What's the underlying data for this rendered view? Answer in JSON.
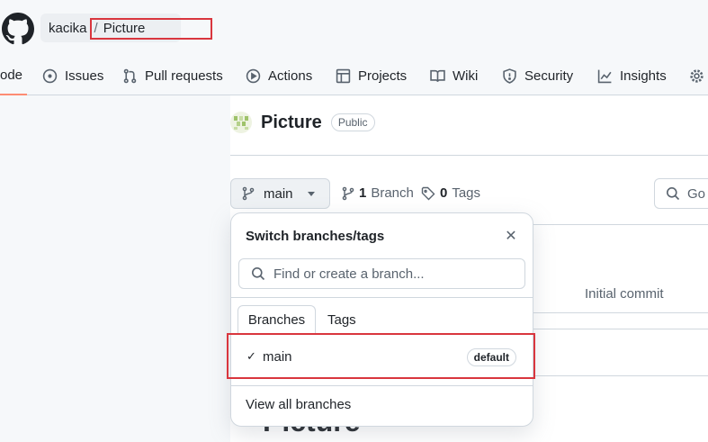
{
  "header": {
    "owner": "kacika",
    "separator": "/",
    "repo": "Picture"
  },
  "tabs": [
    {
      "label": "ode",
      "icon": "code-icon"
    },
    {
      "label": "Issues",
      "icon": "issue-icon"
    },
    {
      "label": "Pull requests",
      "icon": "pull-request-icon"
    },
    {
      "label": "Actions",
      "icon": "play-icon"
    },
    {
      "label": "Projects",
      "icon": "table-icon"
    },
    {
      "label": "Wiki",
      "icon": "book-icon"
    },
    {
      "label": "Security",
      "icon": "shield-icon"
    },
    {
      "label": "Insights",
      "icon": "graph-icon"
    }
  ],
  "repo": {
    "name": "Picture",
    "visibility": "Public"
  },
  "branch_bar": {
    "current_branch": "main",
    "branch_count": "1",
    "branch_label": "Branch",
    "tag_count": "0",
    "tag_label": "Tags",
    "goto_placeholder": "Go"
  },
  "file_table": {
    "commit_message": "Initial commit"
  },
  "readme": {
    "heading": "Picture"
  },
  "dropdown": {
    "title": "Switch branches/tags",
    "search_placeholder": "Find or create a branch...",
    "tab_branches": "Branches",
    "tab_tags": "Tags",
    "branch_name": "main",
    "default_badge": "default",
    "view_all": "View all branches"
  },
  "colors": {
    "highlight_box": "#d9363e",
    "active_tab_underline": "#fd8c73"
  }
}
